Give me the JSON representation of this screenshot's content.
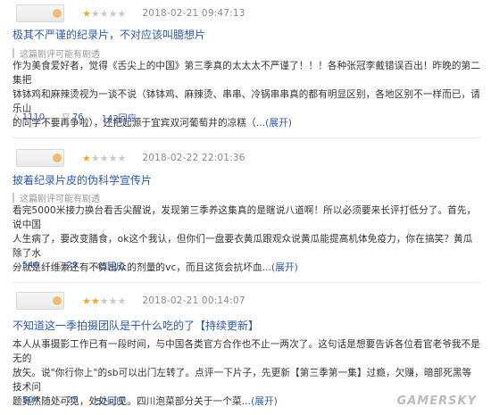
{
  "reviews": [
    {
      "rating": 1,
      "date": "2018-02-21 09:47:13",
      "title": "极其不严谨的纪录片，不对应该叫臆想片",
      "hint": "这篇剧评可能有剧透",
      "body_lines": [
        "作为美食爱好者，觉得《舌尖上的中国》第三季真的太太太不严谨了！！！各种张冠李戴错误百出！昨晚的第二集把",
        "钵钵鸡和麻辣烫视为一谈不说（钵钵鸡、麻辣烫、串串、冷锅串串真的都有明显区别，各地区别不一样而已，请乐山",
        "的同学不要再争啦），还把起源于宜宾双河葡萄井的凉糕（..."
      ],
      "expand_label": "(展开)",
      "up_count": "1110",
      "down_count": "76",
      "reply_label": "142回应"
    },
    {
      "rating": 1,
      "date": "2018-02-22 22:01:36",
      "title": "披着纪录片皮的伪科学宣传片",
      "hint": "这篇剧评可能有剧透",
      "body_lines": [
        "看完5000米接力换台看舌尖醒说，发现第三季养这集真的是瞎说八道啊！所以必须要来长评打低分了。首先，说中国",
        "人生病了，要改变膳食，ok这个我认，但你们一盘要衣黄瓜跟观众说黄瓜能提高机体免疫力，你在搞笑？黄瓜除了水",
        "分就是纤维素还有不算出众的剂量的vc，而且这货会抗坏血...",
        ""
      ],
      "expand_label": "(展开)",
      "up_count": "546",
      "down_count": "29",
      "reply_label": "45回应"
    },
    {
      "rating": 2,
      "date": "2018-02-21 00:14:07",
      "title": "不知道这一季拍摄团队是干什么吃的了",
      "title_link": "【持续更新】",
      "hint": "",
      "body_lines": [
        "本人从事摄影工作已有一段时间，与中国各类官方合作也不止一两次了。这句话是想要告诉各位看官老爷我不是无的",
        "放矢。说\"你行你上\"的sb可以出门左转了。点评一下片子，先更新【第三季第一集】过瘾，欠赚，暗部死黑等技术问",
        "题竟然随处可见，处处可见。四川泡菜部分关于一个菜..."
      ],
      "expand_label": "(展开)",
      "up_count": "504",
      "down_count": "25",
      "reply_label": "57回应"
    }
  ],
  "icons": {
    "up": "triangle-up",
    "down": "triangle-down",
    "star": "star"
  },
  "colors": {
    "link": "#2e5aa8",
    "star_on": "#f5a623",
    "star_off": "#c9c9c9"
  },
  "watermark": "GAMERSKY"
}
